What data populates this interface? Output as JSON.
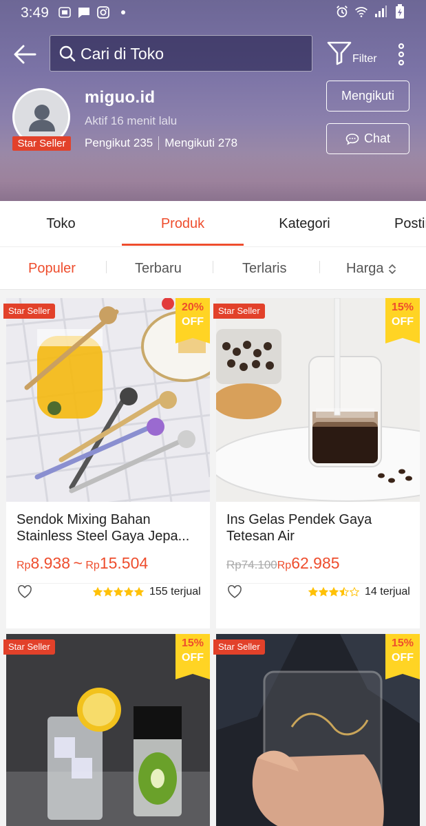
{
  "status_bar": {
    "time": "3:49",
    "left_icons": [
      "toon-blast-icon",
      "message-icon",
      "instagram-icon"
    ],
    "right_icons": [
      "alarm-icon",
      "wifi-icon",
      "signal-icon",
      "battery-charging-icon"
    ]
  },
  "topbar": {
    "search_placeholder": "Cari di Toko",
    "filter_label": "Filter"
  },
  "shop": {
    "name": "miguo.id",
    "active": "Aktif 16 menit lalu",
    "followers": "Pengikut 235",
    "following": "Mengikuti 278",
    "star_badge": "Star Seller",
    "follow_button": "Mengikuti",
    "chat_button": "Chat"
  },
  "tabs": [
    {
      "label": "Toko"
    },
    {
      "label": "Produk"
    },
    {
      "label": "Kategori"
    },
    {
      "label": "Posting"
    }
  ],
  "sort": [
    {
      "label": "Populer"
    },
    {
      "label": "Terbaru"
    },
    {
      "label": "Terlaris"
    },
    {
      "label": "Harga"
    }
  ],
  "products": [
    {
      "badge": "Star Seller",
      "discount_pct": "20%",
      "discount_label": "OFF",
      "title": "Sendok Mixing Bahan Stainless Steel Gaya Jepa...",
      "price_currency": "Rp",
      "price_min": "8.938",
      "price_sep": "~",
      "price_currency2": "Rp",
      "price_max": "15.504",
      "rating": 5,
      "sold": "155 terjual"
    },
    {
      "badge": "Star Seller",
      "discount_pct": "15%",
      "discount_label": "OFF",
      "title": "Ins Gelas Pendek Gaya Tetesan Air",
      "price_old": "Rp74.100",
      "price_currency": "Rp",
      "price": "62.985",
      "rating": 3.5,
      "sold": "14 terjual"
    },
    {
      "badge": "Star Seller",
      "discount_pct": "15%",
      "discount_label": "OFF"
    },
    {
      "badge": "Star Seller",
      "discount_pct": "15%",
      "discount_label": "OFF"
    }
  ],
  "colors": {
    "accent": "#ee4d2d",
    "badge_red": "#e2412a",
    "discount_yellow": "#ffd424",
    "star_yellow": "#ffc107"
  }
}
